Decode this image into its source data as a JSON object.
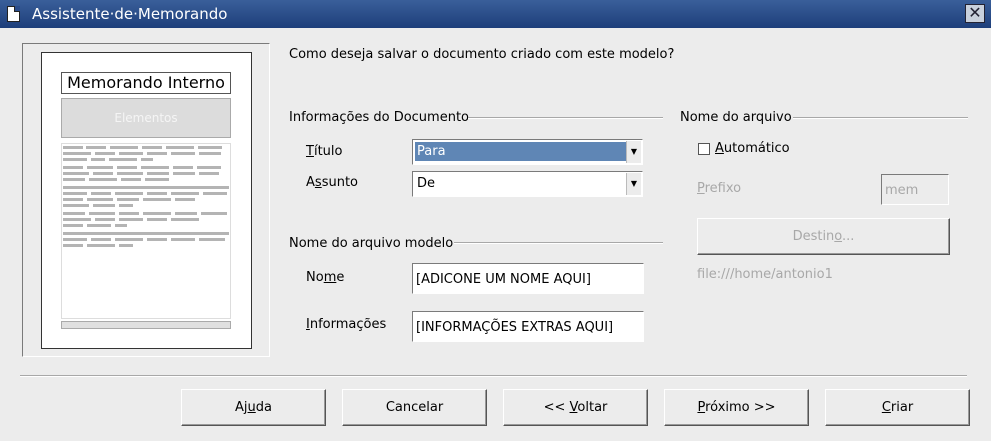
{
  "window": {
    "title": "Assistente·de·Memorando",
    "close_glyph": "✕"
  },
  "preview": {
    "heading": "Memorando Interno",
    "elements_label": "Elementos"
  },
  "question": "Como deseja salvar o documento criado com este modelo?",
  "doc_info": {
    "group_title": "Informações do Documento",
    "title_label_pre": "",
    "title_label_u": "T",
    "title_label_post": "ítulo",
    "title_value": "Para",
    "subject_label_pre": "A",
    "subject_label_u": "s",
    "subject_label_post": "sunto",
    "subject_value": "De"
  },
  "template_name": {
    "group_title": "Nome do arquivo modelo",
    "name_label_pre": "No",
    "name_label_u": "m",
    "name_label_post": "e",
    "name_value": "[ADICONE UM NOME AQUI]",
    "info_label_pre": "",
    "info_label_u": "I",
    "info_label_post": "nformações",
    "info_value": "[INFORMAÇÕES EXTRAS AQUI]"
  },
  "file_name": {
    "group_title": "Nome do arquivo",
    "auto_label_pre": "",
    "auto_label_u": "A",
    "auto_label_post": "utomático",
    "prefix_label_pre": "",
    "prefix_label_u": "P",
    "prefix_label_post": "refixo",
    "prefix_value": "mem",
    "dest_button_pre": "Destin",
    "dest_button_u": "o",
    "dest_button_post": "...",
    "path": "file:///home/antonio1"
  },
  "buttons": {
    "help_pre": "Aj",
    "help_u": "u",
    "help_post": "da",
    "cancel": "Cancelar",
    "back_pre": "<< ",
    "back_u": "V",
    "back_post": "oltar",
    "next_pre": "",
    "next_u": "P",
    "next_post": "róximo >>",
    "create_pre": "",
    "create_u": "C",
    "create_post": "riar"
  }
}
